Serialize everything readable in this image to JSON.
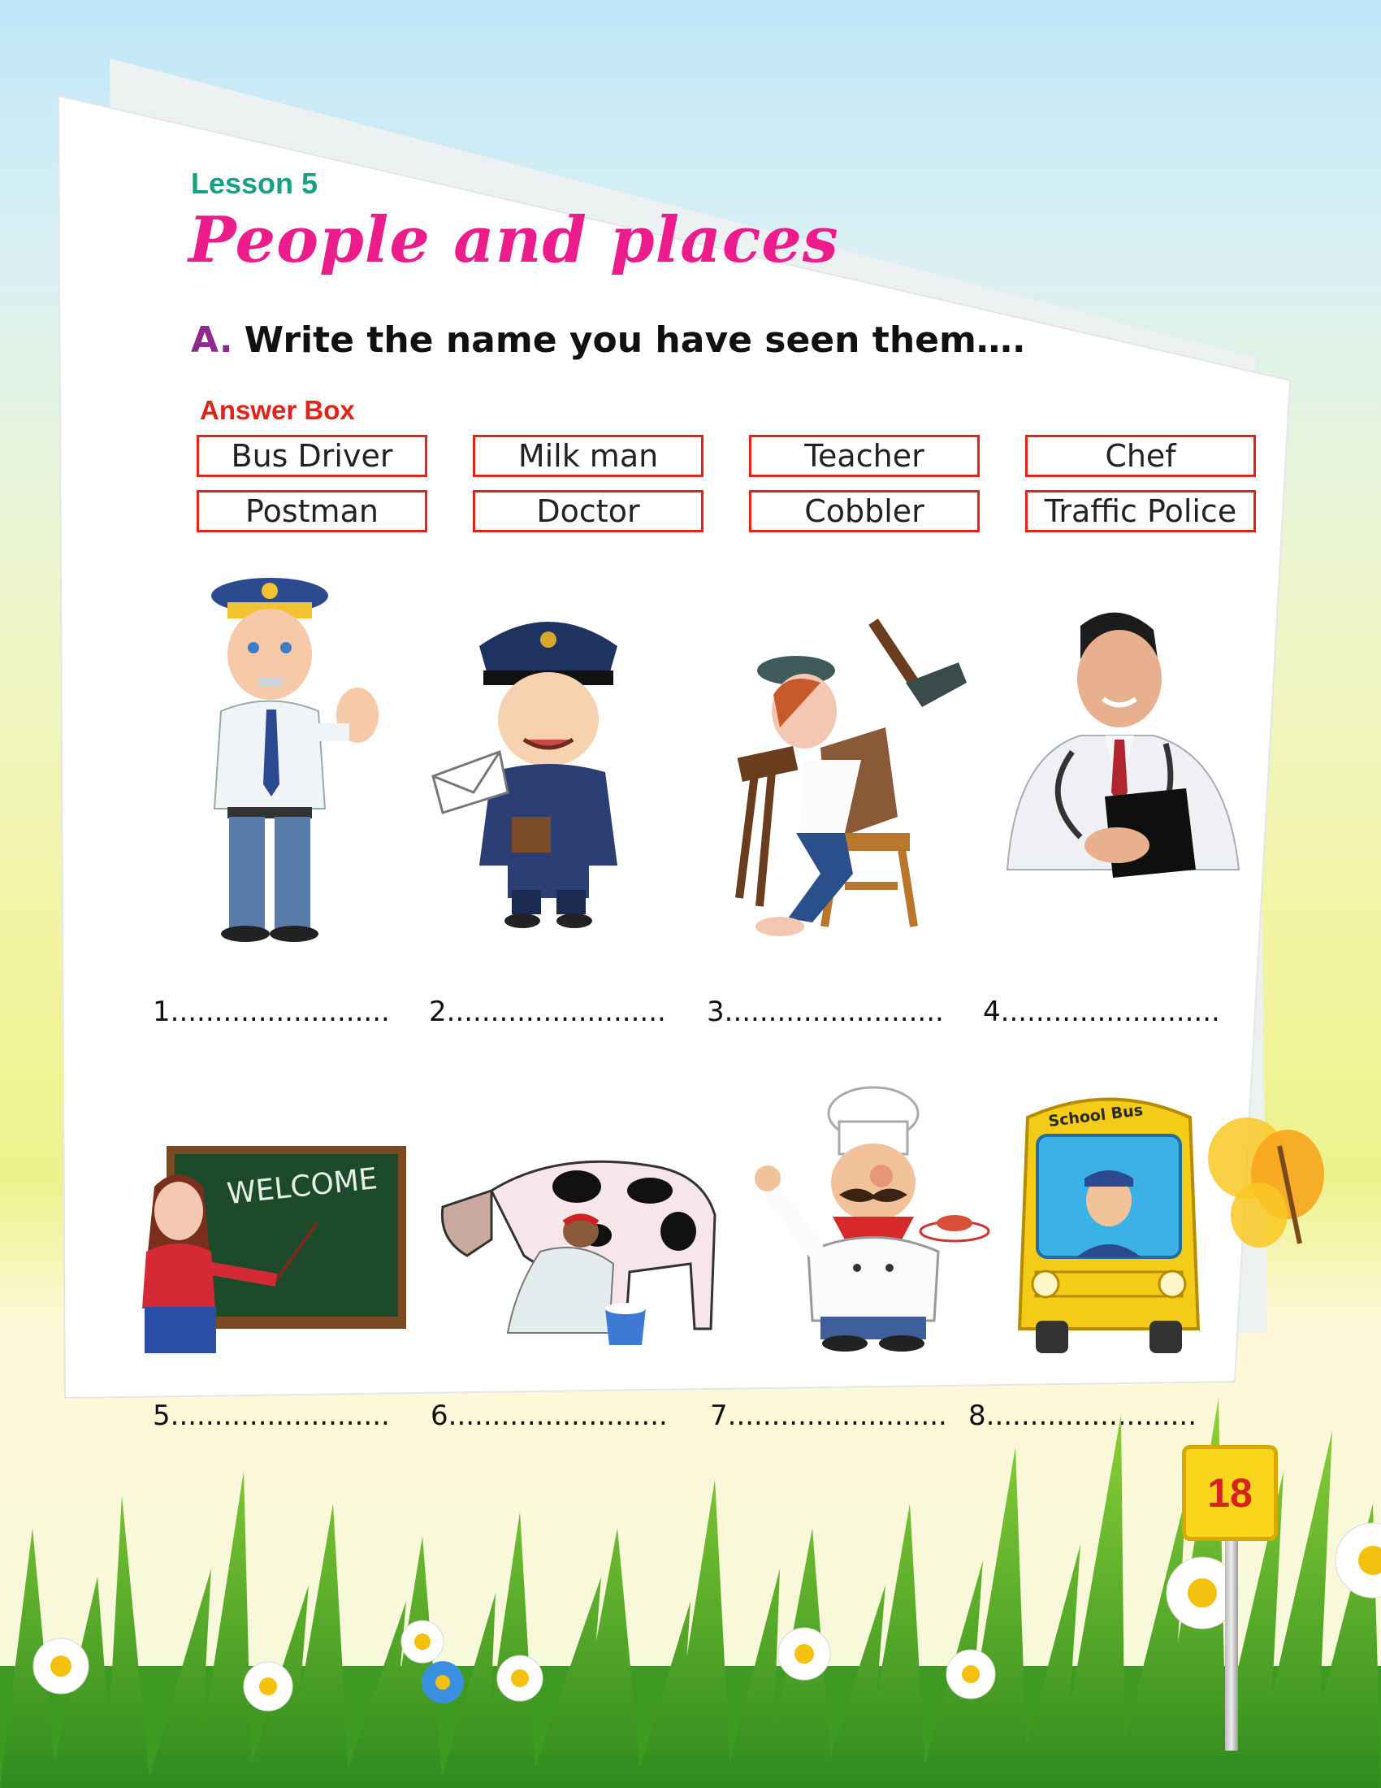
{
  "lesson": "Lesson 5",
  "title": "People and places",
  "instruction": {
    "marker": "A.",
    "text": "Write the name you have seen them…."
  },
  "answer_box": {
    "label": "Answer Box",
    "items": [
      "Bus Driver",
      "Milk man",
      "Teacher",
      "Chef",
      "Postman",
      "Doctor",
      "Cobbler",
      "Traffic Police"
    ]
  },
  "pictures": [
    {
      "icon": "traffic-police-icon"
    },
    {
      "icon": "postman-icon"
    },
    {
      "icon": "cobbler-icon"
    },
    {
      "icon": "doctor-icon"
    },
    {
      "icon": "teacher-icon",
      "board_text": "WELCOME"
    },
    {
      "icon": "milkman-icon"
    },
    {
      "icon": "chef-icon"
    },
    {
      "icon": "bus-driver-icon",
      "bus_text": "School Bus"
    }
  ],
  "blanks": [
    "1.........................",
    "2.........................",
    "3.........................",
    "4.........................",
    "5.........................",
    "6.........................",
    "7.........................",
    "8........................"
  ],
  "page_number": "18",
  "colors": {
    "lesson": "#16a085",
    "title": "#ec1c8c",
    "answer_box": "#e2231a",
    "page_sign": "#f9d61b"
  }
}
